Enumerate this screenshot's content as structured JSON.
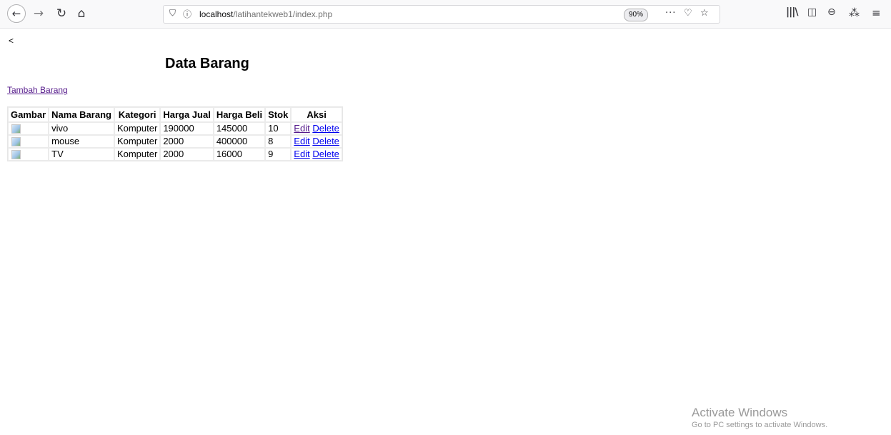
{
  "browser": {
    "url_host": "localhost",
    "url_path": "/latihantekweb1/index.php",
    "zoom": "90%",
    "icons": {
      "back": "arrow-left-icon",
      "forward": "arrow-right-icon",
      "reload": "reload-icon",
      "home": "home-icon",
      "shield": "shield-icon",
      "info": "info-icon",
      "more": "more-icon",
      "pocket": "pocket-icon",
      "star": "star-icon",
      "library": "library-icon",
      "sidebar": "sidebar-icon",
      "account": "account-icon",
      "extension": "extension-icon",
      "menu": "hamburger-menu-icon"
    }
  },
  "page": {
    "back_text": "<",
    "title": "Data Barang",
    "add_link": "Tambah Barang",
    "table": {
      "headers": [
        "Gambar",
        "Nama Barang",
        "Kategori",
        "Harga Jual",
        "Harga Beli",
        "Stok",
        "Aksi"
      ],
      "edit_label": "Edit",
      "delete_label": "Delete",
      "rows": [
        {
          "nama": "vivo",
          "kategori": "Komputer",
          "harga_jual": "190000",
          "harga_beli": "145000",
          "stok": "10"
        },
        {
          "nama": "mouse",
          "kategori": "Komputer",
          "harga_jual": "2000",
          "harga_beli": "400000",
          "stok": "8"
        },
        {
          "nama": "TV",
          "kategori": "Komputer",
          "harga_jual": "2000",
          "harga_beli": "16000",
          "stok": "9"
        }
      ]
    }
  },
  "watermark": {
    "title": "Activate Windows",
    "subtitle": "Go to PC settings to activate Windows."
  }
}
